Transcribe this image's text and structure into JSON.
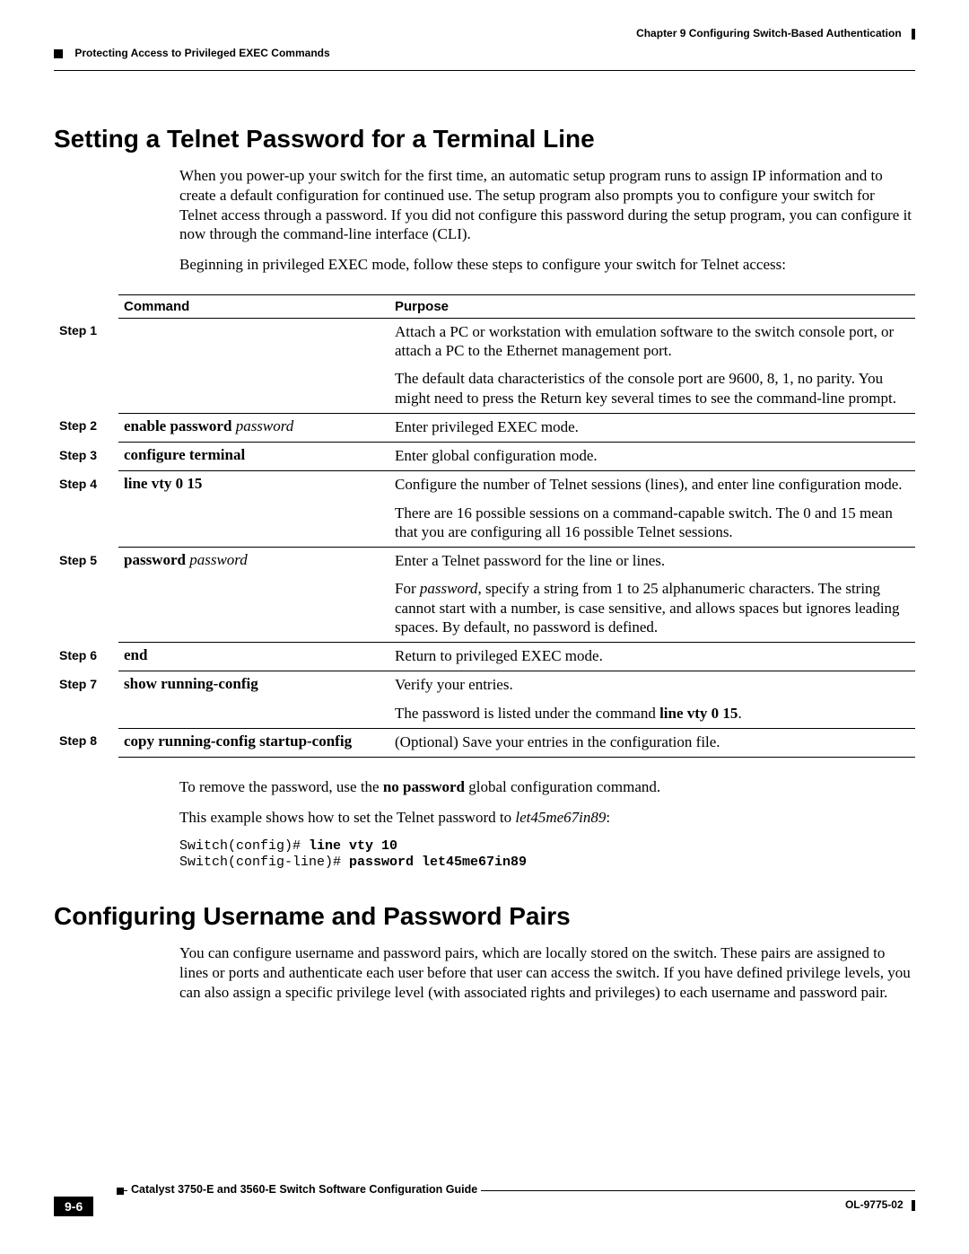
{
  "header": {
    "chapter_label": "Chapter 9",
    "chapter_title": "Configuring Switch-Based Authentication",
    "section_path": "Protecting Access to Privileged EXEC Commands"
  },
  "section1": {
    "title": "Setting a Telnet Password for a Terminal Line",
    "para1": "When you power-up your switch for the first time, an automatic setup program runs to assign IP information and to create a default configuration for continued use. The setup program also prompts you to configure your switch for Telnet access through a password. If you did not configure this password during the setup program, you can configure it now through the command-line interface (CLI).",
    "para2": "Beginning in privileged EXEC mode, follow these steps to configure your switch for Telnet access:"
  },
  "table": {
    "header_command": "Command",
    "header_purpose": "Purpose",
    "rows": [
      {
        "step": "Step 1",
        "command_bold": "",
        "command_ital": "",
        "purpose": [
          "Attach a PC or workstation with emulation software to the switch console port, or attach a PC to the Ethernet management port.",
          "The default data characteristics of the console port are 9600, 8, 1, no parity. You might need to press the Return key several times to see the command-line prompt."
        ]
      },
      {
        "step": "Step 2",
        "command_bold": "enable password",
        "command_ital": " password",
        "purpose": [
          "Enter privileged EXEC mode."
        ]
      },
      {
        "step": "Step 3",
        "command_bold": "configure terminal",
        "command_ital": "",
        "purpose": [
          "Enter global configuration mode."
        ]
      },
      {
        "step": "Step 4",
        "command_bold": "line vty 0 15",
        "command_ital": "",
        "purpose": [
          "Configure the number of Telnet sessions (lines), and enter line configuration mode.",
          "There are 16 possible sessions on a command-capable switch. The 0 and 15 mean that you are configuring all 16 possible Telnet sessions."
        ]
      },
      {
        "step": "Step 5",
        "command_bold": "password",
        "command_ital": " password",
        "purpose_html": [
          "Enter a Telnet password for the line or lines.",
          "For <i>password</i>, specify a string from 1 to 25 alphanumeric characters. The string cannot start with a number, is case sensitive, and allows spaces but ignores leading spaces. By default, no password is defined."
        ]
      },
      {
        "step": "Step 6",
        "command_bold": "end",
        "command_ital": "",
        "purpose": [
          "Return to privileged EXEC mode."
        ]
      },
      {
        "step": "Step 7",
        "command_bold": "show running-config",
        "command_ital": "",
        "purpose_html": [
          "Verify your entries.",
          "The password is listed under the command <b>line vty 0 15</b>."
        ]
      },
      {
        "step": "Step 8",
        "command_bold": "copy running-config startup-config",
        "command_ital": "",
        "purpose": [
          "(Optional) Save your entries in the configuration file."
        ]
      }
    ]
  },
  "after_table": {
    "para1_html": "To remove the password, use the <b>no password</b> global configuration command.",
    "para2_html": "This example shows how to set the Telnet password to <i>let45me67in89</i>:",
    "code_lines": [
      {
        "plain": "Switch(config)# ",
        "bold": "line vty 10"
      },
      {
        "plain": "Switch(config-line)# ",
        "bold": "password let45me67in89"
      }
    ]
  },
  "section2": {
    "title": "Configuring Username and Password Pairs",
    "para1": "You can configure username and password pairs, which are locally stored on the switch. These pairs are assigned to lines or ports and authenticate each user before that user can access the switch. If you have defined privilege levels, you can also assign a specific privilege level (with associated rights and privileges) to each username and password pair."
  },
  "footer": {
    "guide_title": "Catalyst 3750-E and 3560-E Switch Software Configuration Guide",
    "page_number": "9-6",
    "doc_number": "OL-9775-02"
  }
}
